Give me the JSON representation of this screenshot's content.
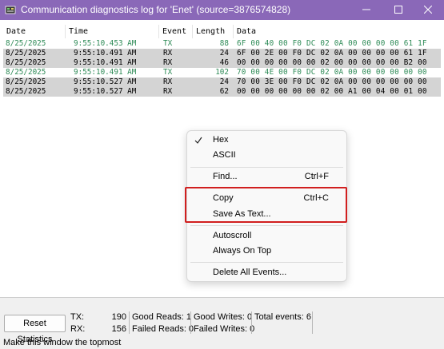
{
  "window": {
    "title": "Communication diagnostics log for 'Enet' (source=3876574828)",
    "accent_color": "#8a68b8",
    "icons": [
      "window-app-icon",
      "minimize-icon",
      "maximize-icon",
      "close-icon"
    ]
  },
  "log": {
    "columns": [
      "Date",
      "Time",
      "Event",
      "Length",
      "Data"
    ],
    "rows": [
      {
        "date": "8/25/2025",
        "time": "9:55:10.453 AM",
        "event": "TX",
        "length": "88",
        "data": "6F 00 40 00 F0 DC 02 0A 00 00 00 00 61 1F"
      },
      {
        "date": "8/25/2025",
        "time": "9:55:10.491 AM",
        "event": "RX",
        "length": "24",
        "data": "6F 00 2E 00 F0 DC 02 0A 00 00 00 00 61 1F"
      },
      {
        "date": "8/25/2025",
        "time": "9:55:10.491 AM",
        "event": "RX",
        "length": "46",
        "data": "00 00 00 00 00 00 02 00 00 00 00 00 B2 00"
      },
      {
        "date": "8/25/2025",
        "time": "9:55:10.491 AM",
        "event": "TX",
        "length": "102",
        "data": "70 00 4E 00 F0 DC 02 0A 00 00 00 00 00 00"
      },
      {
        "date": "8/25/2025",
        "time": "9:55:10.527 AM",
        "event": "RX",
        "length": "24",
        "data": "70 00 3E 00 F0 DC 02 0A 00 00 00 00 00 00"
      },
      {
        "date": "8/25/2025",
        "time": "9:55:10.527 AM",
        "event": "RX",
        "length": "62",
        "data": "00 00 00 00 00 00 02 00 A1 00 04 00 01 00"
      }
    ],
    "tx_color": "#2e8b57",
    "rx_bg_color": "#d4d4d4"
  },
  "menu": {
    "hex": {
      "label": "Hex",
      "checked": true
    },
    "ascii": {
      "label": "ASCII"
    },
    "find": {
      "label": "Find...",
      "shortcut": "Ctrl+F"
    },
    "copy": {
      "label": "Copy",
      "shortcut": "Ctrl+C"
    },
    "save_as_text": {
      "label": "Save As Text..."
    },
    "autoscroll": {
      "label": "Autoscroll"
    },
    "always_on_top": {
      "label": "Always On Top"
    },
    "delete_all": {
      "label": "Delete All Events..."
    },
    "highlight_color": "#d11f1f"
  },
  "stats": {
    "reset_label": "Reset Statistics",
    "tx_label": "TX:",
    "tx_value": "190",
    "rx_label": "RX:",
    "rx_value": "156",
    "good_reads": "Good Reads:  1",
    "failed_reads": "Failed Reads: 0",
    "good_writes": "Good Writes: 0",
    "failed_writes": "Failed Writes: 0",
    "total_events": "Total events:  6"
  },
  "statusbar": {
    "text": "Make this window the topmost"
  }
}
